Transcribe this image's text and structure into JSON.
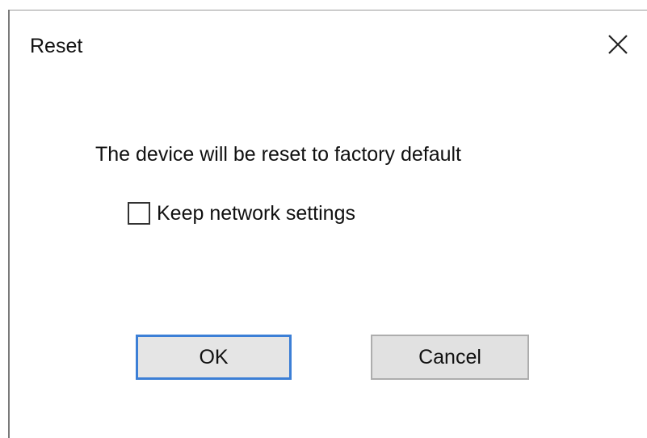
{
  "dialog": {
    "title": "Reset",
    "close_icon": "close-icon",
    "message": "The device will be reset to factory default",
    "checkbox": {
      "label": "Keep network settings",
      "checked": false
    },
    "buttons": {
      "ok_label": "OK",
      "cancel_label": "Cancel"
    }
  },
  "colors": {
    "default_button_border": "#3c7fd6",
    "button_background": "#e1e1e1",
    "text": "#111111"
  }
}
